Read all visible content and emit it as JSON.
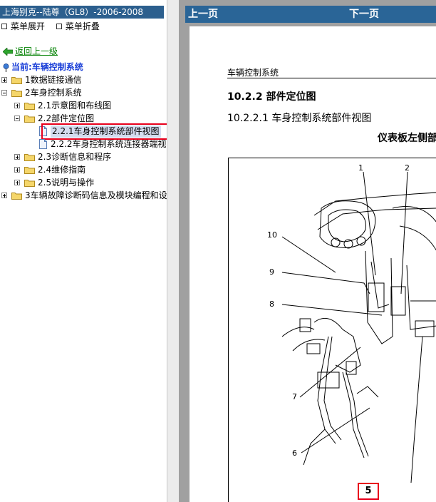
{
  "left_panel": {
    "title": "上海别克--陆尊（GL8）-2006-2008",
    "menu": {
      "expand": "菜单展开",
      "collapse": "菜单折叠"
    },
    "back_link": "返回上一级",
    "current": "当前:车辆控制系统",
    "tree": [
      {
        "label": "1数据链接通信",
        "level": 0,
        "type": "folder",
        "toggle": "plus"
      },
      {
        "label": "2车身控制系统",
        "level": 0,
        "type": "folder",
        "toggle": "minus"
      },
      {
        "label": "2.1示意图和布线图",
        "level": 1,
        "type": "folder",
        "toggle": "plus"
      },
      {
        "label": "2.2部件定位图",
        "level": 1,
        "type": "folder",
        "toggle": "minus"
      },
      {
        "label": "2.2.1车身控制系统部件视图",
        "level": 2,
        "type": "doc",
        "selected": true
      },
      {
        "label": "2.2.2车身控制系统连接器端视",
        "level": 2,
        "type": "doc"
      },
      {
        "label": "2.3诊断信息和程序",
        "level": 1,
        "type": "folder",
        "toggle": "plus"
      },
      {
        "label": "2.4维修指南",
        "level": 1,
        "type": "folder",
        "toggle": "plus"
      },
      {
        "label": "2.5说明与操作",
        "level": 1,
        "type": "folder",
        "toggle": "plus"
      },
      {
        "label": "3车辆故障诊断码信息及模块编程和设",
        "level": 0,
        "type": "folder",
        "toggle": "plus"
      }
    ],
    "colors": {
      "title_bg": "#2c5f8e",
      "link": "#008000",
      "current": "#1a3fd8",
      "highlight": "#e8001c"
    }
  },
  "right_panel": {
    "nav": {
      "prev": "上一页",
      "next": "下一页"
    },
    "doc": {
      "header": "车辆控制系统",
      "section": "10.2.2 部件定位图",
      "subsection": "10.2.2.1 车身控制系统部件视图",
      "figure_title": "仪表板左侧部"
    },
    "callouts": [
      "1",
      "2",
      "10",
      "9",
      "8",
      "7",
      "6",
      "5"
    ],
    "colors": {
      "nav_bg": "#2a6597",
      "background": "#a0a0a0"
    }
  }
}
